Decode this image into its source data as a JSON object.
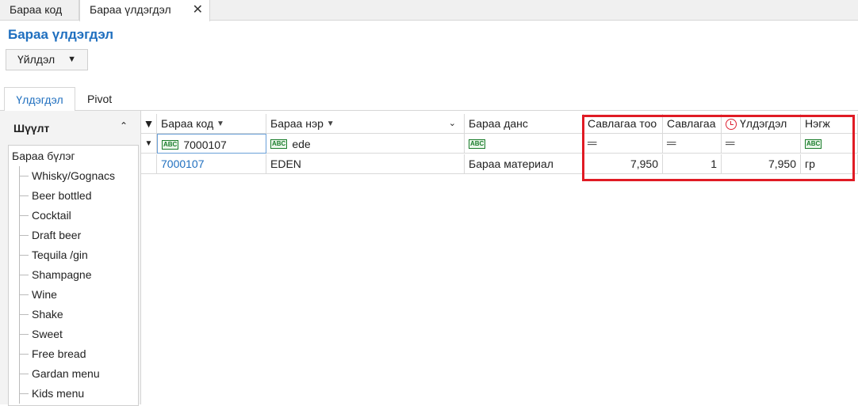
{
  "doc_tabs": [
    {
      "label": "Бараа код"
    },
    {
      "label": "Бараа үлдэгдэл"
    }
  ],
  "page_title": "Бараа үлдэгдэл",
  "action_button": "Үйлдэл",
  "view_tabs": [
    {
      "label": "Үлдэгдэл"
    },
    {
      "label": "Pivot"
    }
  ],
  "filter_panel": {
    "title": "Шүүлт",
    "root": "Бараа бүлэг",
    "items": [
      "Whisky/Gognacs",
      "Beer bottled",
      "Cocktail",
      "Draft beer",
      "Tequila /gin",
      "Shampagne",
      "Wine",
      "Shake",
      "Sweet",
      "Free bread",
      "Gardan menu",
      "Kids menu"
    ]
  },
  "grid": {
    "columns": [
      "Бараа код",
      "Бараа нэр",
      "Бараа данс",
      "Савлагаа тоо",
      "Савлагаа",
      "Үлдэгдэл",
      "Нэгж"
    ],
    "filters": {
      "code": "7000107",
      "name": "ede"
    },
    "rows": [
      {
        "code": "7000107",
        "name": "EDEN",
        "account": "Бараа материал",
        "pack_qty": "7,950",
        "pack": "1",
        "balance": "7,950",
        "unit": "гр"
      }
    ]
  },
  "colors": {
    "accent": "#1f6fbf",
    "highlight": "#e01b24"
  }
}
